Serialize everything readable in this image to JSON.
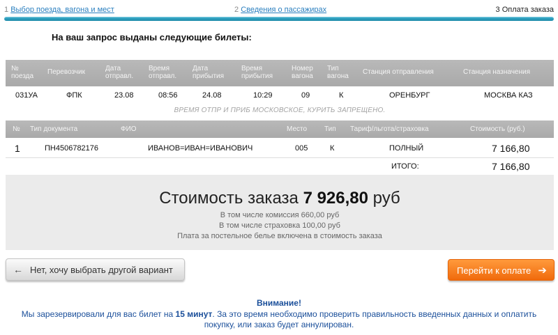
{
  "steps": [
    {
      "num": "1",
      "label": "Выбор поезда, вагона и мест"
    },
    {
      "num": "2",
      "label": "Сведения о пассажирах"
    },
    {
      "num": "3",
      "label": "Оплата заказа"
    }
  ],
  "heading": "На ваш запрос выданы следующие билеты:",
  "train_table": {
    "headers": [
      "№ поезда",
      "Перевозчик",
      "Дата отправл.",
      "Время отправл.",
      "Дата прибытия",
      "Время прибытия",
      "Номер вагона",
      "Тип вагона",
      "Станция отправления",
      "Станция назначения"
    ],
    "row": {
      "train": "031УА",
      "carrier": "ФПК",
      "dep_date": "23.08",
      "dep_time": "08:56",
      "arr_date": "24.08",
      "arr_time": "10:29",
      "car_num": "09",
      "car_type": "К",
      "from": "ОРЕНБУРГ",
      "to": "МОСКВА КАЗ"
    },
    "note": "ВРЕМЯ ОТПР И ПРИБ МОСКОВСКОЕ, КУРИТЬ ЗАПРЕЩЕНО."
  },
  "passenger_table": {
    "headers": [
      "№",
      "Тип документа",
      "ФИО",
      "Место",
      "Тип",
      "Тариф/льгота/страховка",
      "Стоимость (руб.)"
    ],
    "row": {
      "num": "1",
      "doc": "ПН4506782176",
      "name": "ИВАНОВ=ИВАН=ИВАНОВИЧ",
      "seat": "005",
      "type": "К",
      "tariff": "ПОЛНЫЙ",
      "cost": "7 166,80"
    },
    "total_label": "ИТОГО:",
    "total_value": "7 166,80"
  },
  "order_cost": {
    "label": "Стоимость заказа",
    "amount": "7 926,80",
    "currency": "руб",
    "commission": "В том числе комиссия 660,00 руб",
    "insurance": "В том числе страховка 100,00 руб",
    "bedding": "Плата за постельное белье включена в стоимость заказа"
  },
  "buttons": {
    "back_label": "Нет, хочу выбрать другой вариант",
    "pay_label": "Перейти к оплате"
  },
  "warning": {
    "title": "Внимание!",
    "text_before": "Мы зарезервировали для вас билет на",
    "duration": "15 минут",
    "text_after_line1": ". За это время необходимо проверить правильность введенных данных и оплатить",
    "text_line2": "покупку, или заказ будет аннулирован."
  },
  "colors": {
    "progress": "#1d8aa9",
    "pay_button": "#f06a0c",
    "warning_text": "#1b4f9a"
  }
}
